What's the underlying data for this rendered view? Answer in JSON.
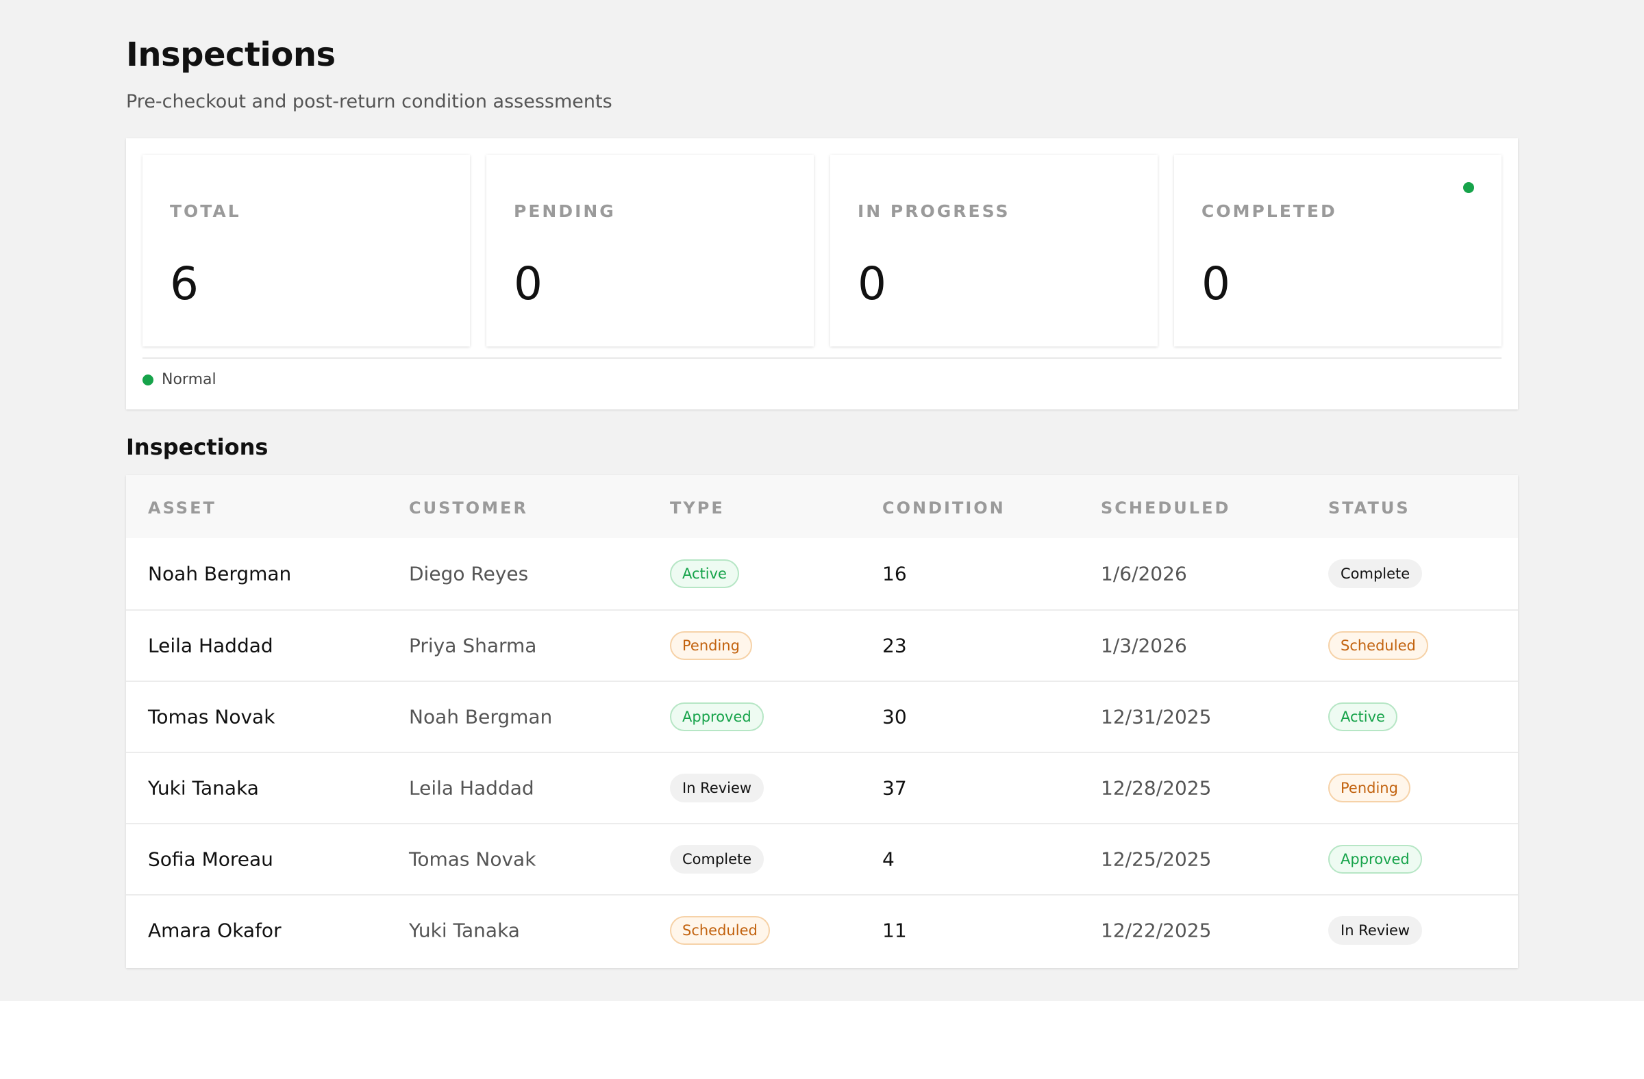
{
  "header": {
    "title": "Inspections",
    "subtitle": "Pre-checkout and post-return condition assessments"
  },
  "stats": [
    {
      "label": "TOTAL",
      "value": "6"
    },
    {
      "label": "PENDING",
      "value": "0"
    },
    {
      "label": "IN PROGRESS",
      "value": "0"
    },
    {
      "label": "COMPLETED",
      "value": "0"
    }
  ],
  "legend": {
    "label": "Normal",
    "color": "#16a34a"
  },
  "table": {
    "title": "Inspections",
    "columns": [
      "ASSET",
      "CUSTOMER",
      "TYPE",
      "CONDITION",
      "SCHEDULED",
      "STATUS"
    ],
    "rows": [
      {
        "asset": "Noah Bergman",
        "customer": "Diego Reyes",
        "type": "Active",
        "condition": "16",
        "scheduled": "1/6/2026",
        "status": "Complete"
      },
      {
        "asset": "Leila Haddad",
        "customer": "Priya Sharma",
        "type": "Pending",
        "condition": "23",
        "scheduled": "1/3/2026",
        "status": "Scheduled"
      },
      {
        "asset": "Tomas Novak",
        "customer": "Noah Bergman",
        "type": "Approved",
        "condition": "30",
        "scheduled": "12/31/2025",
        "status": "Active"
      },
      {
        "asset": "Yuki Tanaka",
        "customer": "Leila Haddad",
        "type": "In Review",
        "condition": "37",
        "scheduled": "12/28/2025",
        "status": "Pending"
      },
      {
        "asset": "Sofia Moreau",
        "customer": "Tomas Novak",
        "type": "Complete",
        "condition": "4",
        "scheduled": "12/25/2025",
        "status": "Approved"
      },
      {
        "asset": "Amara Okafor",
        "customer": "Yuki Tanaka",
        "type": "Scheduled",
        "condition": "11",
        "scheduled": "12/22/2025",
        "status": "In Review"
      }
    ]
  },
  "colors": {
    "accent_green": "#16a34a",
    "accent_orange": "#c2620e",
    "page_background": "#f2f2f2"
  }
}
